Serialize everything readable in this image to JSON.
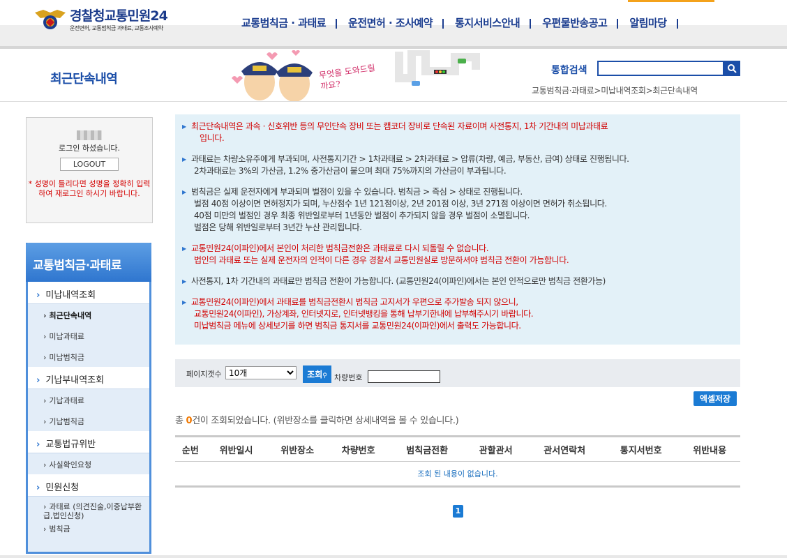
{
  "header": {
    "brand_main": "경찰청",
    "brand_sub": "교통민원24",
    "brand_tagline": "운전면허, 교통범칙금 과태료, 교통조사예약",
    "nav": [
      "교통범칙금 · 과태료",
      "운전면허 · 조사예약",
      "통지서비스안내",
      "우편물반송공고",
      "알림마당"
    ]
  },
  "page": {
    "title": "최근단속내역",
    "banner_text": "무엇을 도와드릴까요?",
    "search_label": "통합검색",
    "breadcrumb": "교통범칙금·과태료>미납내역조회>최근단속내역"
  },
  "login": {
    "message": "로그인 하셨습니다.",
    "logout_label": "LOGOUT",
    "warning": "* 성명이 틀리다면 성명을 정확히 입력하여 재로그인 하시기 바랍니다."
  },
  "sidebar": {
    "title": "교통범칙금·과태료",
    "items": [
      {
        "level": 1,
        "label": "미납내역조회"
      },
      {
        "level": 2,
        "label": "최근단속내역",
        "active": true
      },
      {
        "level": 2,
        "label": "미납과태료"
      },
      {
        "level": 2,
        "label": "미납범칙금"
      },
      {
        "level": 1,
        "label": "기납부내역조회"
      },
      {
        "level": 2,
        "label": "기납과태료"
      },
      {
        "level": 2,
        "label": "기납범칙금"
      },
      {
        "level": 1,
        "label": "교통법규위반"
      },
      {
        "level": 2,
        "label": "사실확인요청"
      },
      {
        "level": 1,
        "label": "민원신청"
      },
      {
        "level": 2,
        "label": "과태료 (의견진술,이중납부환급,법인신청)"
      },
      {
        "level": 2,
        "label": "범칙금"
      }
    ]
  },
  "notice": [
    {
      "red": true,
      "lines": [
        "최근단속내역은 과속 · 신호위반 등의 무인단속 장비 또는 캠코더 장비로 단속된 자료이며 사전통지, 1차 기간내의 미납과태료",
        "입니다."
      ]
    },
    {
      "red": false,
      "lines": [
        "과태료는 차량소유주에게 부과되며, 사전통지기간 > 1차과태료 > 2차과태료 > 압류(차량, 예금, 부동산, 급여) 상태로 진행됩니다.",
        "2차과태료는 3%의 가산금, 1.2% 중가산금이 붙으며 최대 75%까지의 가산금이 부과됩니다."
      ]
    },
    {
      "red": false,
      "lines": [
        "범칙금은 실제 운전자에게 부과되며 벌점이 있을 수 있습니다. 범칙금 > 즉심 > 상태로 진행됩니다.",
        "벌점 40점 이상이면 면허정지가 되며, 누산점수 1년 121점이상, 2년 201점 이상, 3년 271점 이상이면 면허가 취소됩니다.",
        "40점 미만의 벌점인 경우 최종 위반일로부터 1년동안 벌점이 추가되지 않을 경우 벌점이 소멸됩니다.",
        "벌점은 당해 위반일로부터 3년간 누산 관리됩니다."
      ]
    },
    {
      "red": true,
      "lines": [
        "교통민원24(이파인)에서 본인이 처리한 범칙금전환은 과태료로 다시 되돌릴 수 없습니다.",
        "법인의 과태료 또는 실제 운전자의 인적이 다른 경우 경찰서 교통민원실로 방문하셔야 범칙금 전환이 가능합니다."
      ]
    },
    {
      "red": false,
      "lines": [
        "사전통지, 1차 기간내의 과태료만 범칙금 전환이 가능합니다. (교통민원24(이파인)에서는 본인 인적으로만 범칙금 전환가능)"
      ]
    },
    {
      "red": true,
      "lines": [
        "교통민원24(이파인)에서 과태료를 범칙금전환시 범칙금 고지서가 우편으로 추가발송 되지 않으니,",
        "교통민원24(이파인), 가상계좌, 인터넷지로, 인터넷뱅킹을 통해 납부기한내에 납부해주시기 바랍니다.",
        "미납범칙금 메뉴에 상세보기를 하면 범칙금 통지서를 교통민원24(이파인)에서 출력도 가능합니다."
      ]
    }
  ],
  "filter": {
    "page_size_label": "페이지갯수",
    "page_size_value": "10개",
    "search_button": "조회",
    "car_number_label": "차량번호",
    "car_number_value": ""
  },
  "excel_button": "엑셀저장",
  "result": {
    "prefix": "총 ",
    "count": "0",
    "suffix": "건이 조회되었습니다. (위반장소를 클릭하면 상세내역을 볼 수 있습니다.)"
  },
  "table": {
    "columns": [
      "순번",
      "위반일시",
      "위반장소",
      "차량번호",
      "범칙금전환",
      "관할관서",
      "관서연락처",
      "통지서번호",
      "위반내용"
    ],
    "empty_message": "조회 된 내용이 없습니다."
  },
  "pagination": {
    "current": "1"
  },
  "colors": {
    "brand_blue": "#1b3d8f",
    "accent_blue": "#1b7bd4",
    "warning_red": "#d10000",
    "count_orange": "#f07800"
  }
}
